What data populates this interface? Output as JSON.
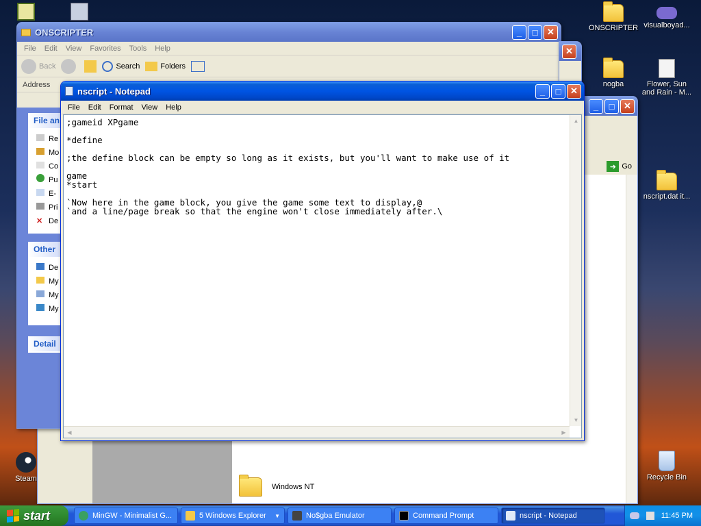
{
  "desktop": {
    "icons": {
      "onscripter": "ONSCRIPTER",
      "visualboy": "visualboyad...",
      "nogba": "nogba",
      "flower": "Flower, Sun and Rain - M...",
      "nscript_dat": "nscript.dat it...",
      "steam": "Steam",
      "recycle": "Recycle Bin"
    }
  },
  "explorer_back": {
    "title": "ONSCRIPTER",
    "menu": [
      "File",
      "Edit",
      "View",
      "Favorites",
      "Tools",
      "Help"
    ],
    "toolbar": {
      "back": "Back",
      "search": "Search",
      "folders": "Folders"
    },
    "address_label": "Address",
    "panes": {
      "file_tasks": "File an",
      "other_places": "Other",
      "details": "Detail"
    },
    "file_task_items": [
      "Re",
      "Mo",
      "Co",
      "Pu",
      "E-",
      "Pri",
      "De"
    ],
    "other_place_items": [
      "De",
      "My",
      "My",
      "My"
    ]
  },
  "explorer_behind": {
    "go": "Go",
    "folder_item": "Windows NT"
  },
  "notepad": {
    "title": "nscript - Notepad",
    "menu": [
      "File",
      "Edit",
      "Format",
      "View",
      "Help"
    ],
    "text": ";gameid XPgame\n\n*define\n\n;the define block can be empty so long as it exists, but you'll want to make use of it\n\ngame\n*start\n\n`Now here in the game block, you give the game some text to display,@\n`and a line/page break so that the engine won't close immediately after.\\"
  },
  "taskbar": {
    "start": "start",
    "tasks": [
      "MinGW - Minimalist G...",
      "5 Windows Explorer",
      "No$gba Emulator",
      "Command Prompt",
      "nscript - Notepad"
    ],
    "clock": "11:45 PM"
  }
}
